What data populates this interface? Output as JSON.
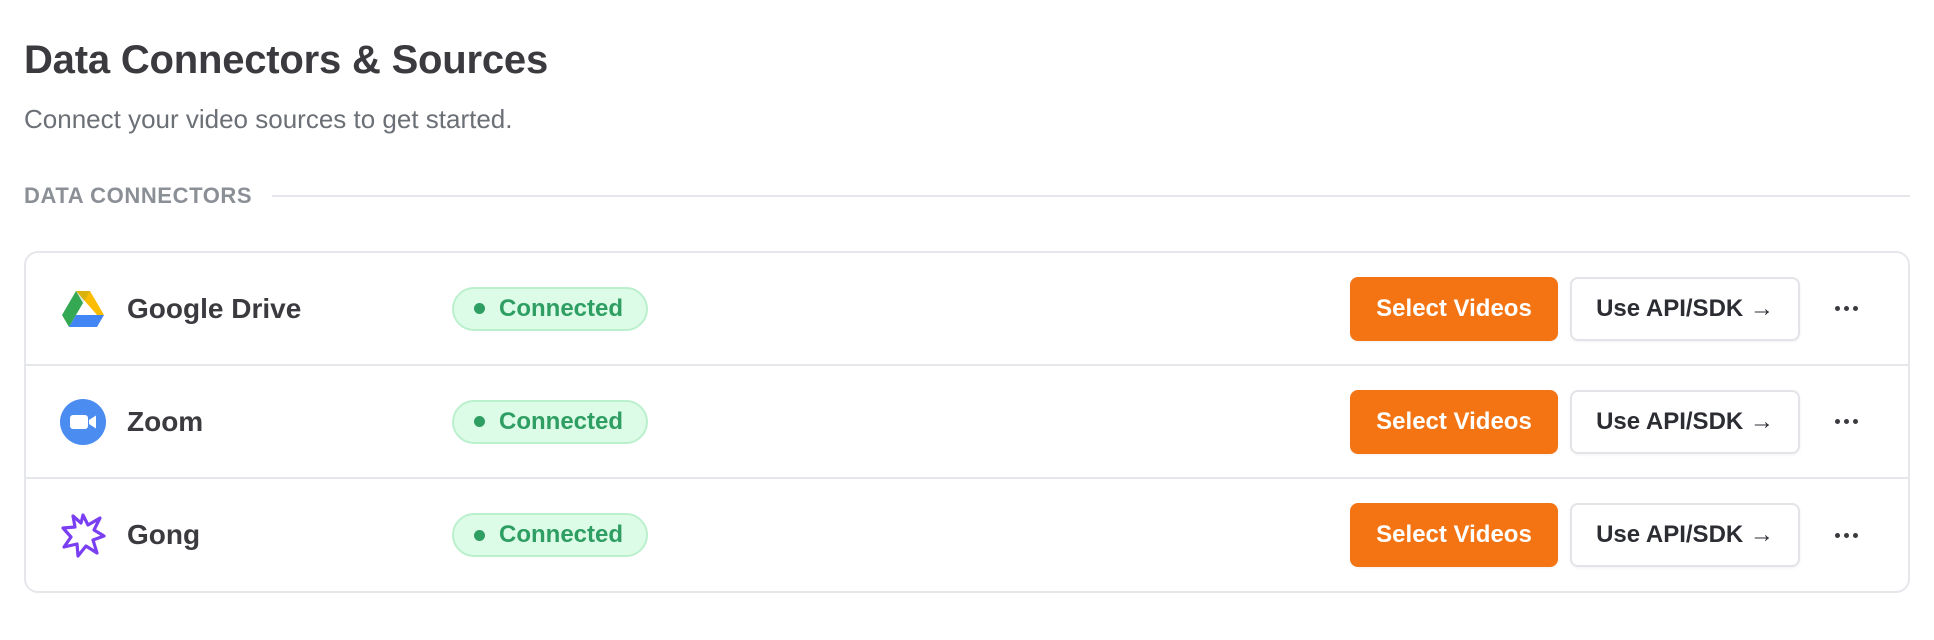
{
  "page": {
    "title": "Data Connectors & Sources",
    "subtitle": "Connect your video sources to get started."
  },
  "section": {
    "label": "DATA CONNECTORS"
  },
  "colors": {
    "accent": "#f47414",
    "status_connected": "#2f9e63",
    "status_connected_bg": "#dcfce7"
  },
  "connectors": [
    {
      "name": "Google Drive",
      "icon": "google-drive-icon",
      "status": "Connected",
      "primary_action": "Select Videos",
      "secondary_action": "Use API/SDK →",
      "more_icon": "more-horizontal-icon"
    },
    {
      "name": "Zoom",
      "icon": "zoom-icon",
      "status": "Connected",
      "primary_action": "Select Videos",
      "secondary_action": "Use API/SDK →",
      "more_icon": "more-horizontal-icon"
    },
    {
      "name": "Gong",
      "icon": "gong-icon",
      "status": "Connected",
      "primary_action": "Select Videos",
      "secondary_action": "Use API/SDK →",
      "more_icon": "more-horizontal-icon"
    }
  ]
}
